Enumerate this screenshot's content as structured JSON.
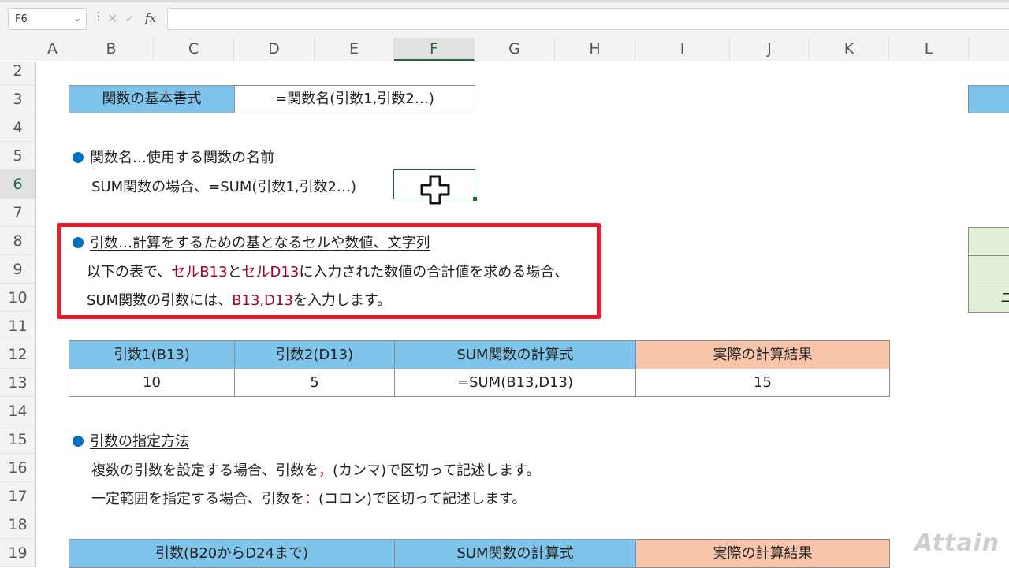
{
  "formula_bar": {
    "name_box": "F6",
    "fx_label": "fx",
    "formula": ""
  },
  "columns": [
    "A",
    "B",
    "C",
    "D",
    "E",
    "F",
    "G",
    "H",
    "I",
    "J",
    "K",
    "L"
  ],
  "selected_column": "F",
  "rows": [
    "2",
    "3",
    "4",
    "5",
    "6",
    "7",
    "8",
    "9",
    "10",
    "11",
    "12",
    "13",
    "14",
    "15",
    "16",
    "17",
    "18",
    "19"
  ],
  "selected_row": "6",
  "sheet": {
    "basic_label": "関数の基本書式",
    "basic_value": "=関数名(引数1,引数2…)",
    "heading_funcname": "関数名…使用する関数の名前",
    "sum_example": "SUM関数の場合、=SUM(引数1,引数2…)",
    "heading_args": "引数…計算をするための基となるセルや数値、文字列",
    "args_line1_a": "以下の表で、",
    "args_line1_b": "セルB13",
    "args_line1_c": "と",
    "args_line1_d": "セルD13",
    "args_line1_e": "に入力された数値の合計値を求める場合、",
    "args_line2_a": "SUM関数の引数には、",
    "args_line2_b": "B13,D13",
    "args_line2_c": "を入力します。",
    "table1": {
      "headers": [
        "引数1(B13)",
        "引数2(D13)",
        "SUM関数の計算式",
        "実際の計算結果"
      ],
      "values": [
        "10",
        "5",
        "=SUM(B13,D13)",
        "15"
      ]
    },
    "heading_method": "引数の指定方法",
    "method_line1_a": "複数の引数を設定する場合、引数を",
    "method_line1_b": "，",
    "method_line1_c": "(カンマ)で区切って記述します。",
    "method_line2_a": "一定範囲を指定する場合、引数を",
    "method_line2_b": "：",
    "method_line2_c": "(コロン)で区切って記述します。",
    "table2": {
      "headers": [
        "引数(B20からD24まで)",
        "SUM関数の計算式",
        "実際の計算結果"
      ]
    },
    "right_partial": "ニ"
  },
  "watermark": "Attain"
}
